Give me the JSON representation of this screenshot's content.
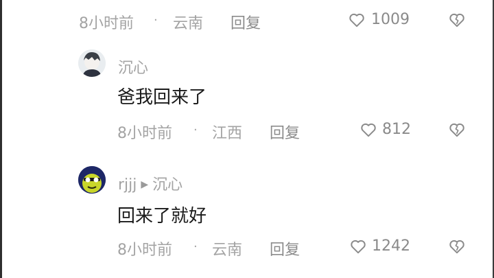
{
  "comments": [
    {
      "time": "8小时前",
      "separator": "·",
      "location": "云南",
      "reply_label": "回复",
      "likes": "1009"
    },
    {
      "username": "沉心",
      "text": "爸我回来了",
      "time": "8小时前",
      "separator": "·",
      "location": "江西",
      "reply_label": "回复",
      "likes": "812"
    },
    {
      "username": "rjjj",
      "reply_to": "沉心",
      "text": "回来了就好",
      "time": "8小时前",
      "separator": "·",
      "location": "云南",
      "reply_label": "回复",
      "likes": "1242"
    }
  ],
  "icons": {
    "like": "heart-outline-icon",
    "dislike": "broken-heart-icon"
  }
}
